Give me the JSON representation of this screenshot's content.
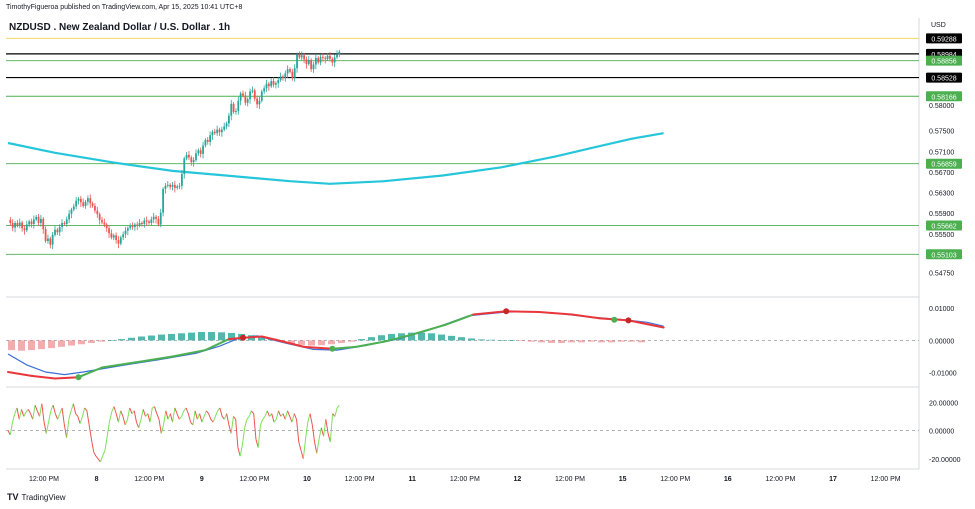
{
  "header": {
    "published_line": "TimothyFigueroa published on TradingView.com, Apr 15, 2025 10:41 UTC+8",
    "title": "NZDUSD . New Zealand Dollar / U.S. Dollar . 1h",
    "currency": "USD"
  },
  "branding": {
    "logo_text": "TradingView",
    "logo_mark": "TV"
  },
  "colors": {
    "up": "#26a69a",
    "down": "#ef5350",
    "ma": "#26c6da",
    "macd": "#3b6fd6",
    "signal": "#e8363b",
    "signal_up": "#4caf50",
    "level": "#4caf50",
    "black": "#000000",
    "yellow": "#f2d24b"
  },
  "chart_data": [
    {
      "type": "candlestick",
      "name": "price",
      "ylim": [
        0.5445,
        0.5945
      ],
      "y_ticks": [
        "0.58000",
        "0.57500",
        "0.57100",
        "0.56700",
        "0.56300",
        "0.55900",
        "0.55500",
        "0.54750"
      ],
      "levels": [
        {
          "value": 0.59288,
          "label": "0.59288",
          "style": "yellow"
        },
        {
          "value": 0.58988,
          "label": "0.58988",
          "style": "black"
        },
        {
          "value": 0.58984,
          "label": "0.58984",
          "style": "price"
        },
        {
          "value": 0.58856,
          "label": "0.58856",
          "style": "green"
        },
        {
          "value": 0.58528,
          "label": "0.58528",
          "style": "black"
        },
        {
          "value": 0.58166,
          "label": "0.58166",
          "style": "green"
        },
        {
          "value": 0.56859,
          "label": "0.56859",
          "style": "green"
        },
        {
          "value": 0.55662,
          "label": "0.55662",
          "style": "green"
        },
        {
          "value": 0.55103,
          "label": "0.55103",
          "style": "green"
        }
      ],
      "close_path": [
        0.5577,
        0.5571,
        0.5562,
        0.5571,
        0.5566,
        0.5572,
        0.5561,
        0.5557,
        0.5568,
        0.5574,
        0.5569,
        0.5578,
        0.5583,
        0.5571,
        0.5579,
        0.5559,
        0.5536,
        0.5541,
        0.5529,
        0.5548,
        0.5558,
        0.5553,
        0.5563,
        0.5571,
        0.5569,
        0.5578,
        0.5589,
        0.5597,
        0.5603,
        0.5614,
        0.5618,
        0.5611,
        0.5604,
        0.5612,
        0.5619,
        0.5609,
        0.5604,
        0.5595,
        0.5588,
        0.5577,
        0.5572,
        0.5568,
        0.5561,
        0.5551,
        0.5543,
        0.5547,
        0.5538,
        0.5531,
        0.5543,
        0.5549,
        0.5556,
        0.5561,
        0.5565,
        0.5563,
        0.5568,
        0.5566,
        0.5571,
        0.5569,
        0.5576,
        0.5574,
        0.5571,
        0.5578,
        0.5583,
        0.5579,
        0.5568,
        0.5591,
        0.5637,
        0.5643,
        0.5645,
        0.5641,
        0.5645,
        0.5639,
        0.5642,
        0.5643,
        0.5666,
        0.5696,
        0.5703,
        0.5698,
        0.5689,
        0.5693,
        0.5706,
        0.5712,
        0.5705,
        0.5721,
        0.5732,
        0.5728,
        0.5741,
        0.5748,
        0.5745,
        0.5752,
        0.5747,
        0.5752,
        0.5758,
        0.5764,
        0.5779,
        0.5802,
        0.5786,
        0.5788,
        0.5808,
        0.5822,
        0.5818,
        0.5804,
        0.5811,
        0.5826,
        0.5828,
        0.5812,
        0.5801,
        0.5808,
        0.5826,
        0.5832,
        0.5841,
        0.5836,
        0.5846,
        0.5839,
        0.5842,
        0.5848,
        0.5855,
        0.5852,
        0.5861,
        0.5869,
        0.5864,
        0.5852,
        0.5871,
        0.5898,
        0.5892,
        0.5896,
        0.5888,
        0.5879,
        0.5887,
        0.5869,
        0.5878,
        0.5891,
        0.5882,
        0.5893,
        0.5891,
        0.5889,
        0.5895,
        0.5889,
        0.5882,
        0.5892,
        0.5898,
        0.5903
      ],
      "moving_average": {
        "label": "",
        "points": [
          [
            0,
            0.5726
          ],
          [
            20,
            0.5707
          ],
          [
            45,
            0.5688
          ],
          [
            70,
            0.5672
          ],
          [
            95,
            0.5662
          ],
          [
            120,
            0.5652
          ],
          [
            137,
            0.5647
          ],
          [
            160,
            0.5652
          ],
          [
            185,
            0.5663
          ],
          [
            210,
            0.5679
          ],
          [
            233,
            0.57
          ],
          [
            250,
            0.5718
          ],
          [
            265,
            0.5734
          ],
          [
            279,
            0.5745
          ]
        ]
      },
      "x_ticks": [
        "12:00 PM",
        "8",
        "12:00 PM",
        "9",
        "12:00 PM",
        "10",
        "12:00 PM",
        "11",
        "12:00 PM",
        "12",
        "12:00 PM",
        "15",
        "12:00 PM",
        "16",
        "12:00 PM",
        "17",
        "12:00 PM"
      ]
    },
    {
      "type": "macd",
      "name": "macd",
      "ylim": [
        -0.0135,
        0.0125
      ],
      "y_ticks": [
        "0.01000",
        "0.00000",
        "-0.01000"
      ],
      "macd_line": [
        [
          0,
          -0.0042
        ],
        [
          8,
          -0.0076
        ],
        [
          16,
          -0.0098
        ],
        [
          24,
          -0.0106
        ],
        [
          32,
          -0.0098
        ],
        [
          48,
          -0.0078
        ],
        [
          64,
          -0.006
        ],
        [
          80,
          -0.004
        ],
        [
          90,
          -0.0018
        ],
        [
          98,
          0.0006
        ],
        [
          106,
          0.0014
        ],
        [
          118,
          -0.0008
        ],
        [
          130,
          -0.0028
        ],
        [
          140,
          -0.003
        ],
        [
          152,
          -0.0016
        ],
        [
          166,
          0.0004
        ],
        [
          180,
          0.0034
        ],
        [
          196,
          0.0076
        ],
        [
          212,
          0.0088
        ],
        [
          224,
          0.0089
        ],
        [
          236,
          0.0082
        ],
        [
          248,
          0.0072
        ],
        [
          262,
          0.0064
        ],
        [
          272,
          0.0056
        ],
        [
          279,
          0.0044
        ]
      ],
      "signal_line": [
        [
          0,
          -0.0098
        ],
        [
          10,
          -0.011
        ],
        [
          20,
          -0.0118
        ],
        [
          30,
          -0.0114
        ],
        [
          40,
          -0.0084
        ],
        [
          56,
          -0.0066
        ],
        [
          70,
          -0.005
        ],
        [
          84,
          -0.003
        ],
        [
          94,
          0.0004
        ],
        [
          100,
          0.0008
        ],
        [
          108,
          0.0012
        ],
        [
          114,
          0.0002
        ],
        [
          126,
          -0.002
        ],
        [
          138,
          -0.0026
        ],
        [
          148,
          -0.002
        ],
        [
          160,
          -0.0004
        ],
        [
          172,
          0.0018
        ],
        [
          186,
          0.0048
        ],
        [
          198,
          0.008
        ],
        [
          212,
          0.009
        ],
        [
          226,
          0.0088
        ],
        [
          240,
          0.008
        ],
        [
          252,
          0.0068
        ],
        [
          264,
          0.0062
        ],
        [
          279,
          0.004
        ]
      ],
      "signal_up_ranges": [
        [
          30,
          94
        ],
        [
          138,
          200
        ]
      ],
      "cross_points": [
        {
          "x": 30,
          "value": -0.0114,
          "dir": "up"
        },
        {
          "x": 100,
          "value": 0.0008,
          "dir": "down"
        },
        {
          "x": 138,
          "value": -0.0026,
          "dir": "up"
        },
        {
          "x": 212,
          "value": 0.009,
          "dir": "down"
        },
        {
          "x": 258,
          "value": 0.0064,
          "dir": "up"
        },
        {
          "x": 264,
          "value": 0.0062,
          "dir": "down"
        }
      ],
      "histogram": [
        -0.003,
        -0.0032,
        -0.003,
        -0.0027,
        -0.0024,
        -0.002,
        -0.0016,
        -0.0012,
        -0.0008,
        -0.0004,
        0.0,
        0.0004,
        0.0008,
        0.0012,
        0.0015,
        0.0018,
        0.002,
        0.0022,
        0.0024,
        0.0026,
        0.0026,
        0.0025,
        0.0023,
        0.002,
        0.0016,
        0.001,
        0.0004,
        -0.0004,
        -0.001,
        -0.0014,
        -0.0016,
        -0.0015,
        -0.0012,
        -0.0008,
        -0.0004,
        0.0004,
        0.001,
        0.0016,
        0.002,
        0.0022,
        0.0024,
        0.0024,
        0.0022,
        0.0018,
        0.0014,
        0.001,
        0.0006,
        0.0003,
        0.0002,
        0.0001,
        0.0,
        -0.0002,
        -0.0004,
        -0.0006,
        -0.0008,
        -0.0008,
        -0.0006,
        -0.0006,
        -0.0004,
        -0.0006,
        -0.0006,
        -0.0004,
        -0.0004,
        -0.0006
      ]
    },
    {
      "type": "oscillator",
      "name": "rsi",
      "ylim": [
        -25,
        28
      ],
      "y_ticks": [
        "20.00000",
        "0.00000",
        "-20.00000"
      ],
      "values": [
        0,
        -3,
        6,
        12,
        16,
        8,
        15,
        10,
        13,
        15,
        12,
        8,
        18,
        14,
        10,
        19,
        6,
        -2,
        6,
        14,
        18,
        12,
        8,
        12,
        16,
        4,
        -5,
        8,
        14,
        19,
        12,
        10,
        5,
        10,
        16,
        14,
        4,
        -6,
        -15,
        -18,
        -20,
        -22,
        -18,
        -14,
        -4,
        6,
        13,
        17,
        12,
        6,
        14,
        10,
        4,
        8,
        16,
        12,
        14,
        6,
        2,
        8,
        15,
        10,
        12,
        6,
        16,
        17,
        12,
        8,
        -2,
        4,
        14,
        8,
        12,
        6,
        16,
        12,
        8,
        10,
        14,
        16,
        12,
        6,
        4,
        14,
        8,
        12,
        6,
        10,
        14,
        12,
        8,
        6,
        10,
        14,
        16,
        10,
        8,
        12,
        4,
        -2,
        10,
        8,
        -12,
        -18,
        -10,
        2,
        8,
        10,
        14,
        12,
        -6,
        -12,
        4,
        8,
        10,
        14,
        10,
        12,
        6,
        8,
        14,
        10,
        12,
        8,
        14,
        10,
        6,
        12,
        8,
        -8,
        -14,
        -20,
        -6,
        6,
        12,
        4,
        -8,
        -16,
        -6,
        2,
        -4,
        8,
        -2,
        -8,
        12,
        10,
        16,
        18
      ]
    }
  ]
}
